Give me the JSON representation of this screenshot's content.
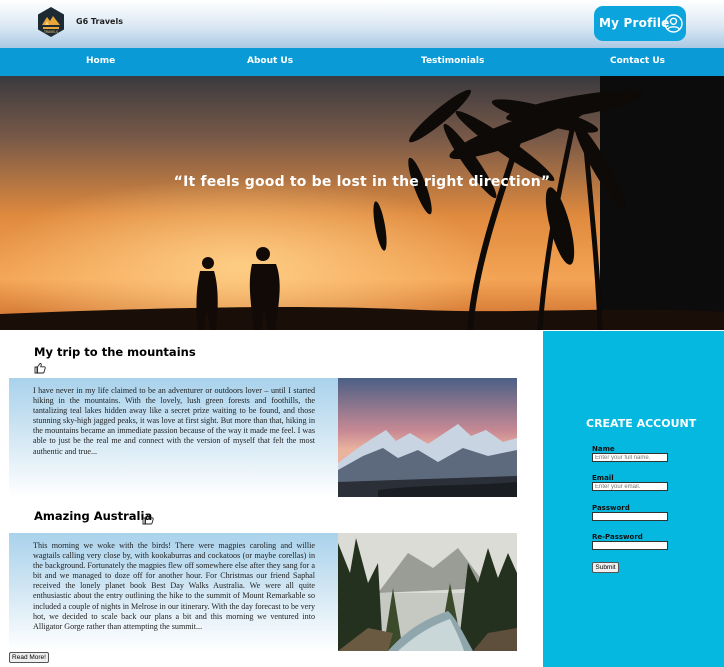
{
  "header": {
    "brand": "G6 Travels",
    "logo_text": "TRAVELS",
    "profile_label": "My Profile"
  },
  "nav": {
    "items": [
      "Home",
      "About Us",
      "Testimonials",
      "Contact Us"
    ]
  },
  "hero": {
    "quote": "“It feels good to be lost in the right direction”"
  },
  "posts": [
    {
      "title": "My trip to the mountains",
      "text": "I have never in my life claimed to be an adventurer or outdoors lover – until I started hiking in the mountains. With the lovely, lush green forests and foothills, the tantalizing teal lakes hidden away like a secret prize waiting to be found, and those stunning sky-high jagged peaks, it was love at first sight. But more than that, hiking in the mountains became an immediate passion because of the way it made me feel. I was able to just be the real me and connect with the version of myself that felt the most authentic and true..."
    },
    {
      "title": "Amazing Australia",
      "text": "This morning we woke with the birds! There were magpies caroling and willie wagtails calling very close by, with kookaburras and cockatoos (or maybe corellas) in the background. Fortunately the magpies flew off somewhere else after they sang for a bit and we managed to doze off for another hour. For Christmas our friend Saphal received the lonely planet book Best Day Walks Australia. We were all quite enthusiastic about the entry outlining the hike to the summit of Mount Remarkable so included a couple of nights in Melrose in our itinerary. With the day forecast to be very hot, we decided to scale back our plans a bit and this morning we ventured into Alligator Gorge rather than attempting the summit..."
    }
  ],
  "read_more_label": "Read More!",
  "signup": {
    "title": "CREATE ACCOUNT",
    "name_label": "Name",
    "name_placeholder": "Enter your full name.",
    "email_label": "Email",
    "email_placeholder": "Enter your email.",
    "password_label": "Password",
    "repassword_label": "Re-Password",
    "submit_label": "Submit"
  },
  "colors": {
    "nav_bg": "#0a9bd6",
    "profile_bg": "#0ba4dd",
    "sidebar_bg": "#05b8e0"
  },
  "icons": [
    "logo-icon",
    "user-icon",
    "thumbs-up-icon"
  ]
}
